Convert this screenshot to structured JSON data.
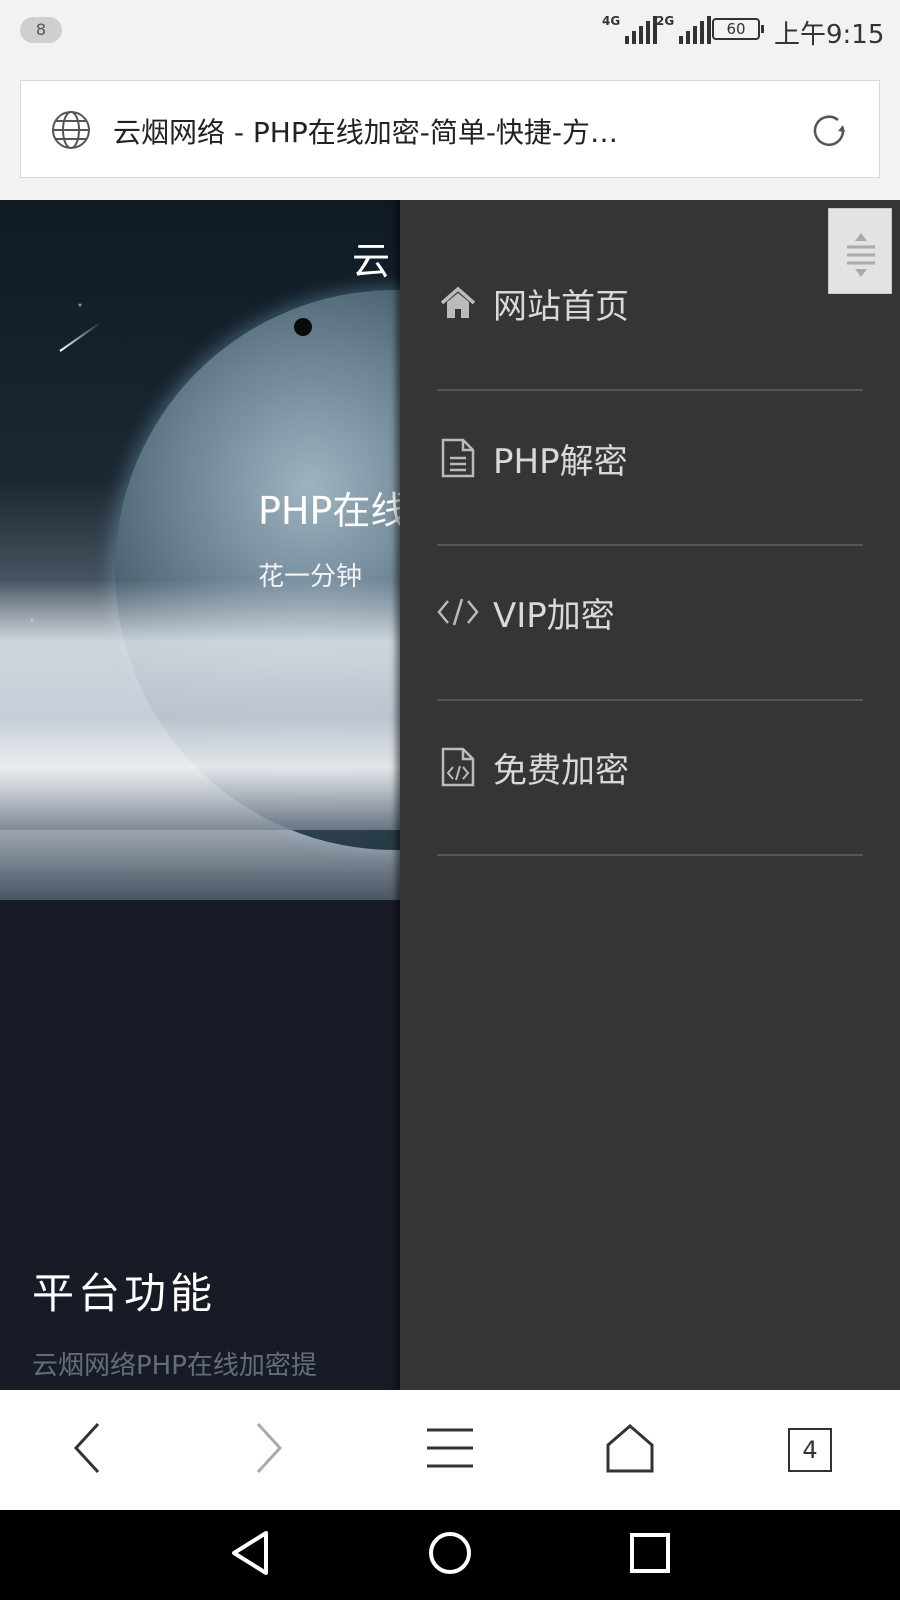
{
  "status_bar": {
    "notification_count": "8",
    "network_1": "4G",
    "network_2": "2G",
    "battery": "60",
    "time": "上午9:15"
  },
  "browser": {
    "page_title": "云烟网络 - PHP在线加密-简单-快捷-方…",
    "tab_count": "4"
  },
  "hero": {
    "brand_partial": "云",
    "headline_partial": "PHP在线",
    "subtitle_partial": "花一分钟"
  },
  "section": {
    "title": "平台功能",
    "description_partial": "云烟网络PHP在线加密提"
  },
  "drawer": {
    "items": [
      {
        "label": "网站首页",
        "icon": "home-icon"
      },
      {
        "label": "PHP解密",
        "icon": "file-text-icon"
      },
      {
        "label": "VIP加密",
        "icon": "code-icon"
      },
      {
        "label": "免费加密",
        "icon": "file-code-icon"
      }
    ]
  },
  "colors": {
    "drawer_bg": "#353535",
    "content_bg": "#171b25",
    "menu_text": "#d9d9d9"
  }
}
